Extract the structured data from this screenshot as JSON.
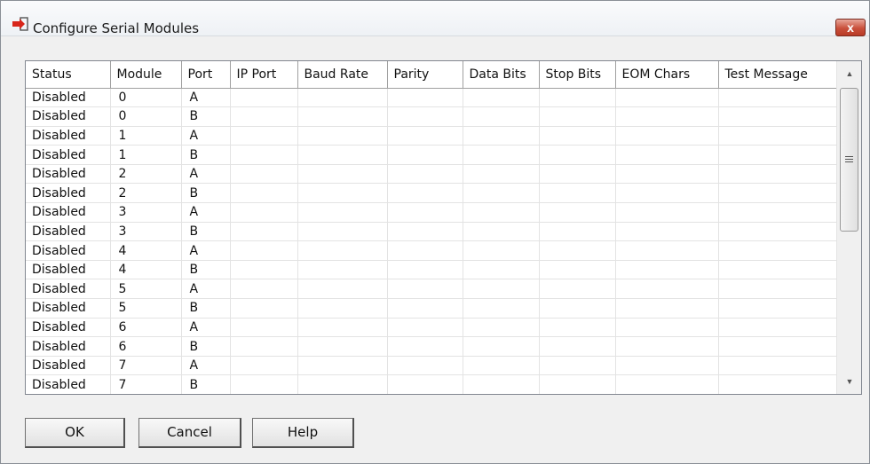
{
  "window": {
    "title": "Configure Serial Modules",
    "close_label": "x"
  },
  "table": {
    "columns": [
      "Status",
      "Module",
      "Port",
      "IP Port",
      "Baud Rate",
      "Parity",
      "Data Bits",
      "Stop Bits",
      "EOM Chars",
      "Test Message"
    ],
    "rows": [
      [
        "Disabled",
        "0",
        "A",
        "",
        "",
        "",
        "",
        "",
        "",
        ""
      ],
      [
        "Disabled",
        "0",
        "B",
        "",
        "",
        "",
        "",
        "",
        "",
        ""
      ],
      [
        "Disabled",
        "1",
        "A",
        "",
        "",
        "",
        "",
        "",
        "",
        ""
      ],
      [
        "Disabled",
        "1",
        "B",
        "",
        "",
        "",
        "",
        "",
        "",
        ""
      ],
      [
        "Disabled",
        "2",
        "A",
        "",
        "",
        "",
        "",
        "",
        "",
        ""
      ],
      [
        "Disabled",
        "2",
        "B",
        "",
        "",
        "",
        "",
        "",
        "",
        ""
      ],
      [
        "Disabled",
        "3",
        "A",
        "",
        "",
        "",
        "",
        "",
        "",
        ""
      ],
      [
        "Disabled",
        "3",
        "B",
        "",
        "",
        "",
        "",
        "",
        "",
        ""
      ],
      [
        "Disabled",
        "4",
        "A",
        "",
        "",
        "",
        "",
        "",
        "",
        ""
      ],
      [
        "Disabled",
        "4",
        "B",
        "",
        "",
        "",
        "",
        "",
        "",
        ""
      ],
      [
        "Disabled",
        "5",
        "A",
        "",
        "",
        "",
        "",
        "",
        "",
        ""
      ],
      [
        "Disabled",
        "5",
        "B",
        "",
        "",
        "",
        "",
        "",
        "",
        ""
      ],
      [
        "Disabled",
        "6",
        "A",
        "",
        "",
        "",
        "",
        "",
        "",
        ""
      ],
      [
        "Disabled",
        "6",
        "B",
        "",
        "",
        "",
        "",
        "",
        "",
        ""
      ],
      [
        "Disabled",
        "7",
        "A",
        "",
        "",
        "",
        "",
        "",
        "",
        ""
      ],
      [
        "Disabled",
        "7",
        "B",
        "",
        "",
        "",
        "",
        "",
        "",
        ""
      ]
    ]
  },
  "buttons": {
    "ok": "OK",
    "cancel": "Cancel",
    "help": "Help"
  },
  "icons": {
    "title": "serial-plug-icon",
    "close": "close-icon"
  },
  "colors": {
    "close_button": "#c9503b",
    "icon_red": "#d8261b"
  }
}
